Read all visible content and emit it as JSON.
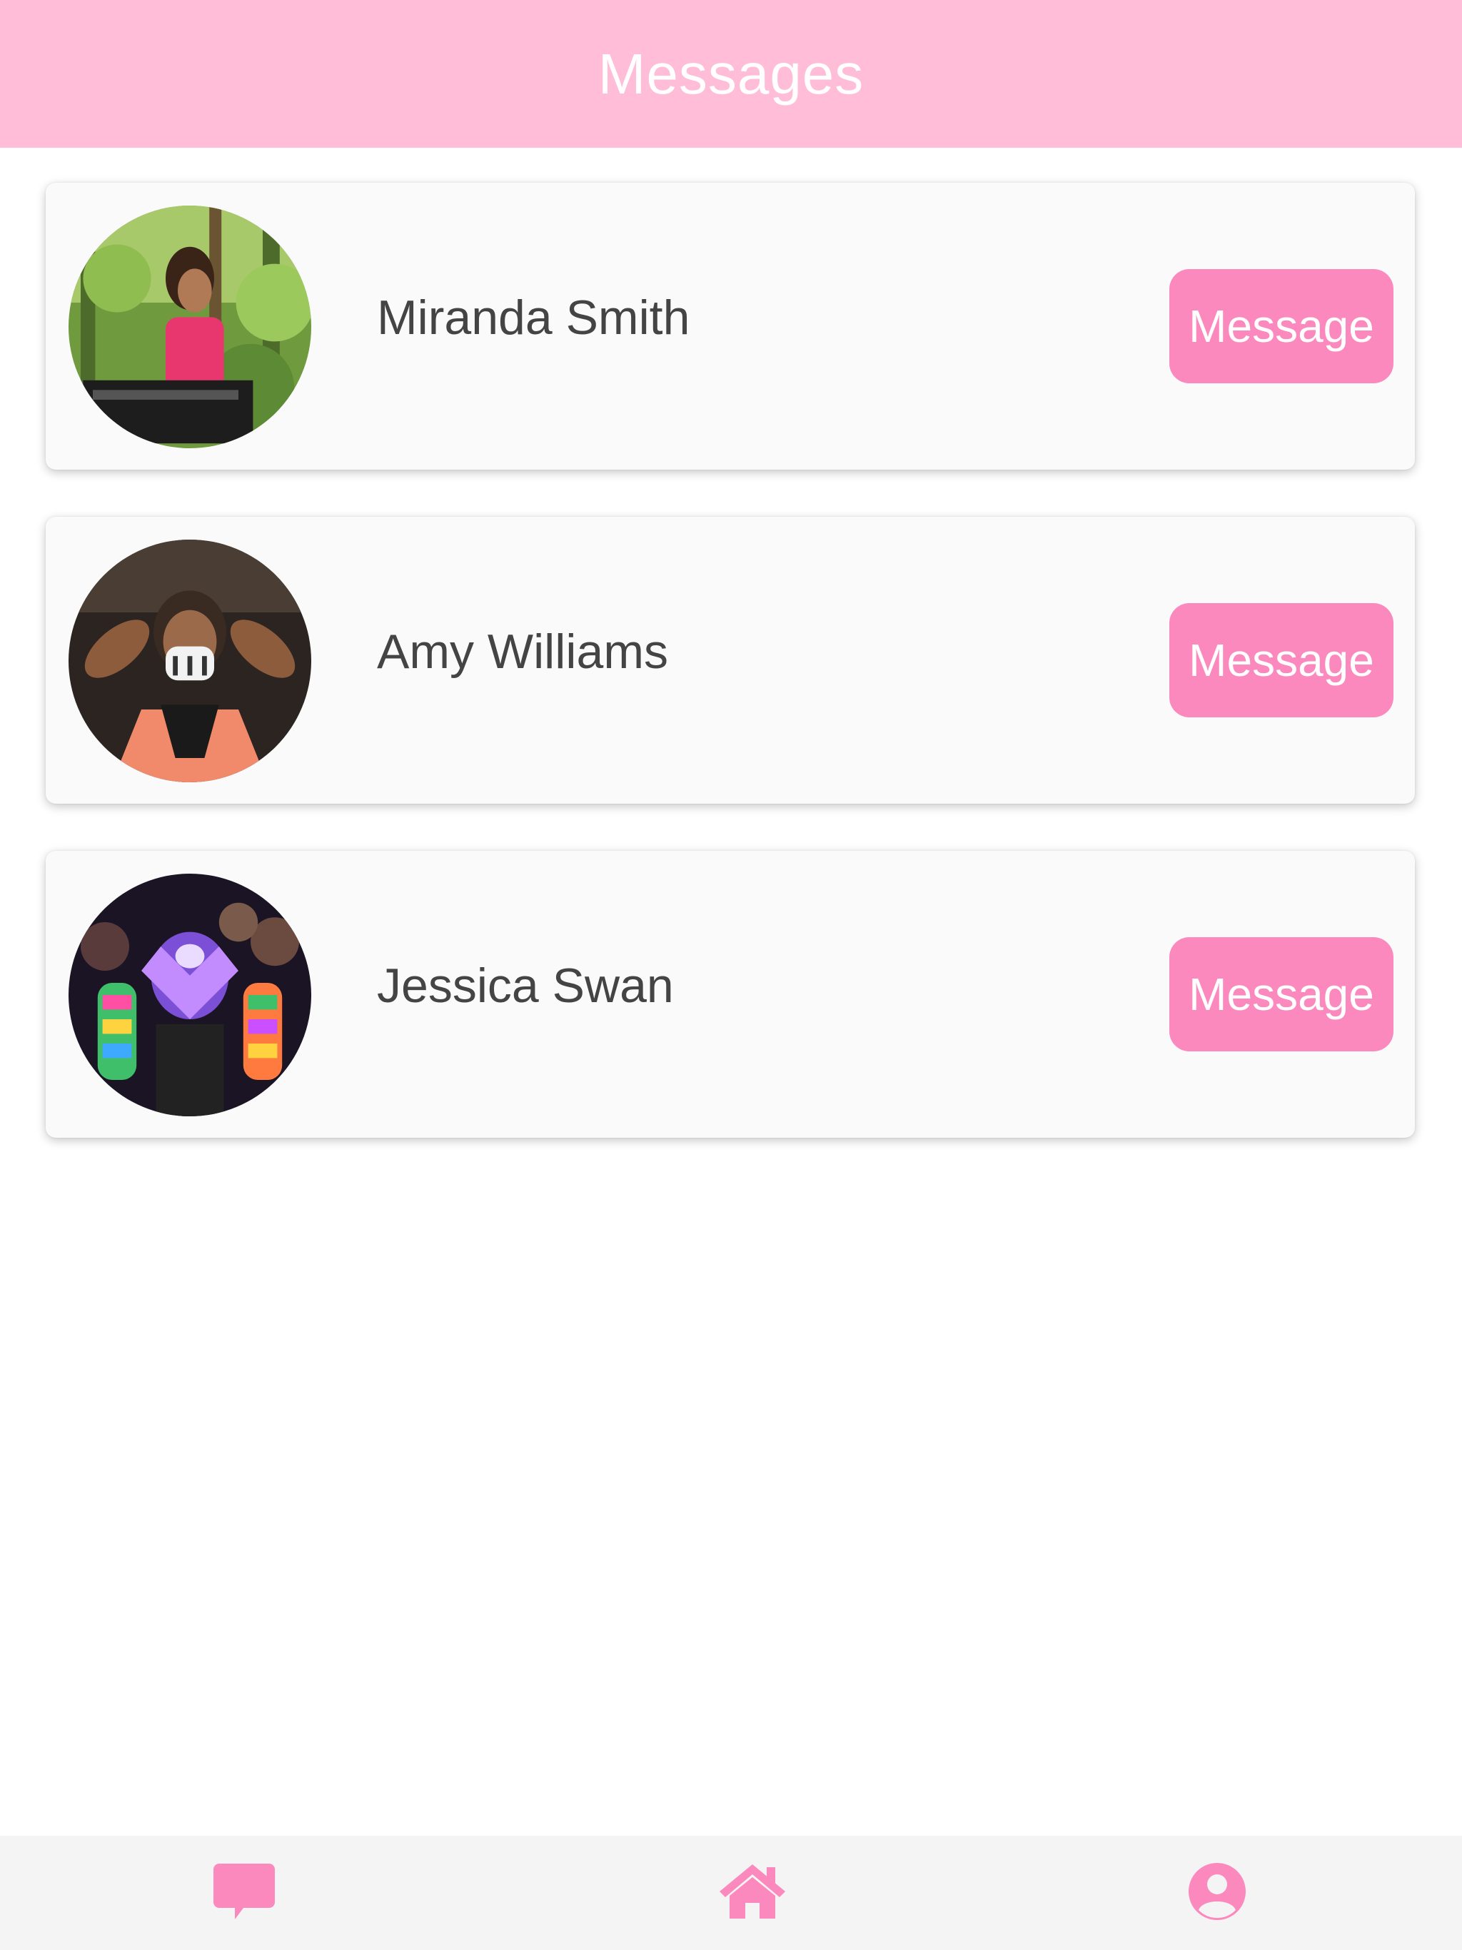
{
  "header": {
    "title": "Messages"
  },
  "contacts": [
    {
      "name": "Miranda Smith",
      "button_label": "Message"
    },
    {
      "name": "Amy Williams",
      "button_label": "Message"
    },
    {
      "name": "Jessica Swan",
      "button_label": "Message"
    }
  ],
  "tabbar": {
    "tabs": [
      {
        "icon": "chat-bubble-icon"
      },
      {
        "icon": "home-icon"
      },
      {
        "icon": "user-circle-icon"
      }
    ]
  },
  "colors": {
    "header_bg": "#ffbdd7",
    "accent": "#fb89bd",
    "card_bg": "#fafafa",
    "tabbar_bg": "#f4f4f4",
    "text": "#444444"
  }
}
